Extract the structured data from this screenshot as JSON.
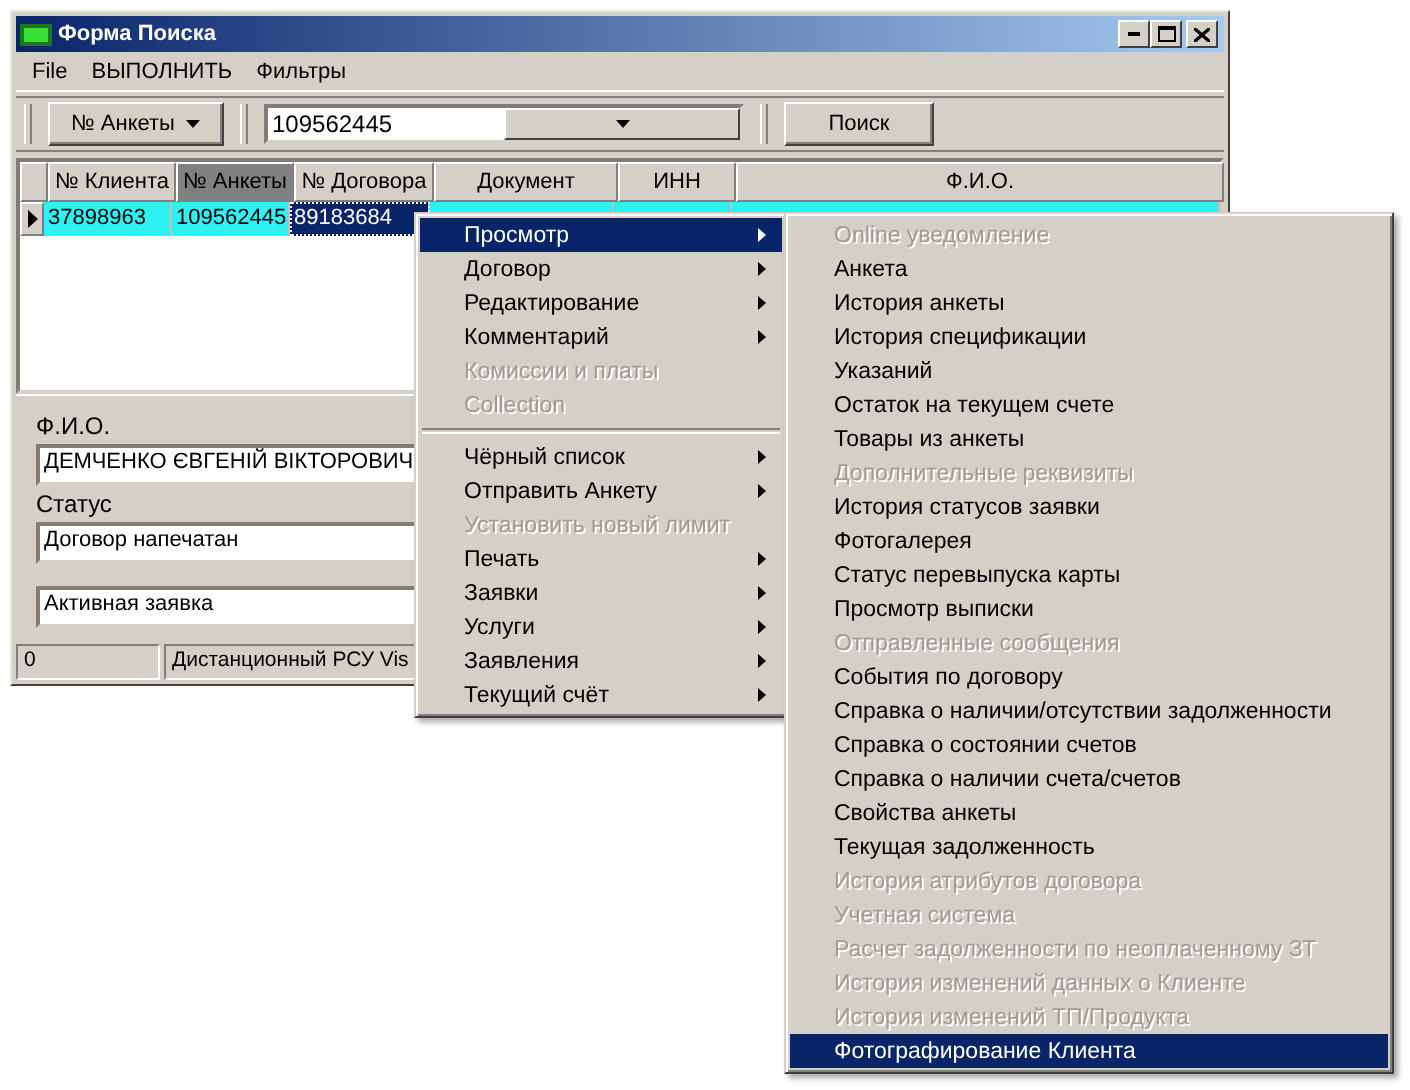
{
  "window": {
    "title": "Форма Поиска"
  },
  "menu_bar": [
    "File",
    "ВЫПОЛНИТЬ",
    "Фильтры"
  ],
  "toolbar": {
    "field_button": "№ Анкеты",
    "search_value": "109562445",
    "search_button": "Поиск"
  },
  "grid": {
    "columns": [
      {
        "label": "№ Клиента",
        "selected": false
      },
      {
        "label": "№ Анкеты",
        "selected": true
      },
      {
        "label": "№ Договора",
        "selected": false
      },
      {
        "label": "Документ",
        "selected": false
      },
      {
        "label": "ИНН",
        "selected": false
      },
      {
        "label": "Ф.И.О.",
        "selected": false
      }
    ],
    "rows": [
      {
        "current": true,
        "cells": [
          {
            "text": "37898963",
            "focused": false
          },
          {
            "text": "109562445",
            "focused": false
          },
          {
            "text": "89183684",
            "focused": true
          }
        ]
      }
    ]
  },
  "details": {
    "fio_label": "Ф.И.О.",
    "fio": "ДЕМЧЕНКО ЄВГЕНІЙ ВІКТОРОВИЧ",
    "status_label": "Статус",
    "status": "Договор напечатан",
    "state": "Активная заявка"
  },
  "status_bar": [
    "0",
    "Дистанционный РСУ Vis"
  ],
  "context_menu": {
    "items": [
      {
        "kind": "item",
        "label": "Просмотр",
        "disabled": false,
        "selected": true,
        "submenu": true
      },
      {
        "kind": "item",
        "label": "Договор",
        "disabled": false,
        "selected": false,
        "submenu": true
      },
      {
        "kind": "item",
        "label": "Редактирование",
        "disabled": false,
        "selected": false,
        "submenu": true
      },
      {
        "kind": "item",
        "label": "Комментарий",
        "disabled": false,
        "selected": false,
        "submenu": true
      },
      {
        "kind": "item",
        "label": "Комиссии и платы",
        "disabled": true,
        "selected": false,
        "submenu": false
      },
      {
        "kind": "item",
        "label": "Collection",
        "disabled": true,
        "selected": false,
        "submenu": false
      },
      {
        "kind": "separator"
      },
      {
        "kind": "item",
        "label": "Чёрный список",
        "disabled": false,
        "selected": false,
        "submenu": true
      },
      {
        "kind": "item",
        "label": "Отправить Анкету",
        "disabled": false,
        "selected": false,
        "submenu": true
      },
      {
        "kind": "item",
        "label": "Установить новый лимит",
        "disabled": true,
        "selected": false,
        "submenu": false
      },
      {
        "kind": "item",
        "label": "Печать",
        "disabled": false,
        "selected": false,
        "submenu": true
      },
      {
        "kind": "item",
        "label": "Заявки",
        "disabled": false,
        "selected": false,
        "submenu": true
      },
      {
        "kind": "item",
        "label": "Услуги",
        "disabled": false,
        "selected": false,
        "submenu": true
      },
      {
        "kind": "item",
        "label": "Заявления",
        "disabled": false,
        "selected": false,
        "submenu": true
      },
      {
        "kind": "item",
        "label": "Текущий счёт",
        "disabled": false,
        "selected": false,
        "submenu": true
      }
    ]
  },
  "submenu": {
    "items": [
      {
        "kind": "item",
        "label": "Online уведомление",
        "disabled": true,
        "selected": false
      },
      {
        "kind": "item",
        "label": "Анкета",
        "disabled": false,
        "selected": false
      },
      {
        "kind": "item",
        "label": "История анкеты",
        "disabled": false,
        "selected": false
      },
      {
        "kind": "item",
        "label": "История спецификации",
        "disabled": false,
        "selected": false
      },
      {
        "kind": "item",
        "label": "Указаний",
        "disabled": false,
        "selected": false
      },
      {
        "kind": "item",
        "label": "Остаток на текущем счете",
        "disabled": false,
        "selected": false
      },
      {
        "kind": "item",
        "label": "Товары из анкеты",
        "disabled": false,
        "selected": false
      },
      {
        "kind": "item",
        "label": "Дополнительные реквизиты",
        "disabled": true,
        "selected": false
      },
      {
        "kind": "item",
        "label": "История статусов заявки",
        "disabled": false,
        "selected": false
      },
      {
        "kind": "item",
        "label": "Фотогалерея",
        "disabled": false,
        "selected": false
      },
      {
        "kind": "item",
        "label": "Статус перевыпуска карты",
        "disabled": false,
        "selected": false
      },
      {
        "kind": "item",
        "label": "Просмотр выписки",
        "disabled": false,
        "selected": false
      },
      {
        "kind": "item",
        "label": "Отправленные сообщения",
        "disabled": true,
        "selected": false
      },
      {
        "kind": "item",
        "label": "События по договору",
        "disabled": false,
        "selected": false
      },
      {
        "kind": "item",
        "label": "Справка о наличии/отсутствии задолженности",
        "disabled": false,
        "selected": false
      },
      {
        "kind": "item",
        "label": "Справка о состоянии счетов",
        "disabled": false,
        "selected": false
      },
      {
        "kind": "item",
        "label": "Справка о наличии счета/счетов",
        "disabled": false,
        "selected": false
      },
      {
        "kind": "item",
        "label": "Свойства анкеты",
        "disabled": false,
        "selected": false
      },
      {
        "kind": "item",
        "label": "Текущая задолженность",
        "disabled": false,
        "selected": false
      },
      {
        "kind": "item",
        "label": "История атрибутов договора",
        "disabled": true,
        "selected": false
      },
      {
        "kind": "item",
        "label": "Учетная система",
        "disabled": true,
        "selected": false
      },
      {
        "kind": "item",
        "label": "Расчет задолженности по неоплаченному ЗТ",
        "disabled": true,
        "selected": false
      },
      {
        "kind": "item",
        "label": "История изменений данных о Клиенте",
        "disabled": true,
        "selected": false
      },
      {
        "kind": "item",
        "label": "История изменений ТП/Продукта",
        "disabled": true,
        "selected": false
      },
      {
        "kind": "item",
        "label": "Фотографирование Клиента",
        "disabled": false,
        "selected": true
      }
    ]
  }
}
